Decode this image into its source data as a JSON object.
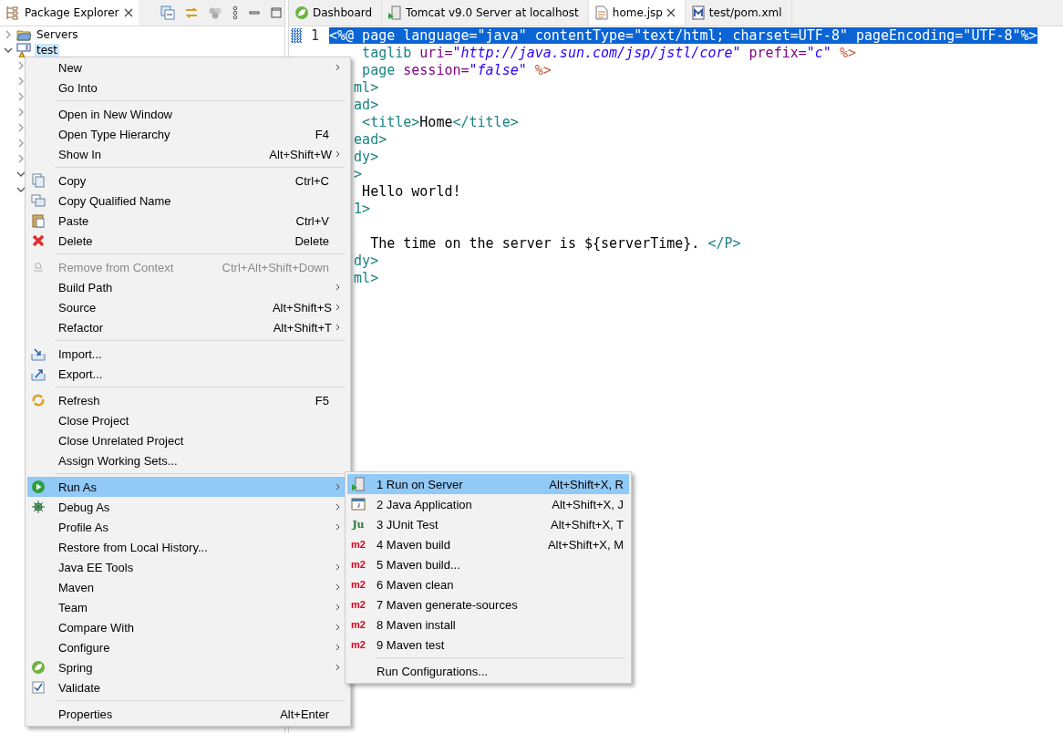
{
  "explorer": {
    "tab": {
      "label": "Package Explorer",
      "selected": true
    },
    "tree": [
      {
        "label": "Servers",
        "expanded": false,
        "selected": false
      },
      {
        "label": "test",
        "expanded": true,
        "selected": true,
        "children": [
          {
            "expanded": false
          },
          {
            "expanded": false
          },
          {
            "expanded": false
          },
          {
            "expanded": false
          },
          {
            "expanded": false
          },
          {
            "expanded": false
          },
          {
            "expanded": false
          },
          {
            "expanded": true
          },
          {
            "expanded": true
          }
        ]
      }
    ]
  },
  "editor": {
    "tabs": [
      {
        "label": "Dashboard",
        "kind": "spring",
        "selected": false
      },
      {
        "label": "Tomcat v9.0 Server at localhost",
        "kind": "server",
        "selected": false
      },
      {
        "label": "home.jsp",
        "kind": "file",
        "selected": true
      },
      {
        "label": "test/pom.xml",
        "kind": "maven",
        "selected": false
      }
    ],
    "line_number": "1",
    "blocks": [
      [
        {
          "selected": true,
          "segments": [
            {
              "text": "<%@ page language=\"java\" contentType=\"text/html; charset=UTF-8\" pageEncoding=\"UTF-8\"%>",
              "kind": "plain"
            }
          ]
        },
        {
          "selected": false,
          "segments": [
            {
              "text": "    taglib ",
              "kind": "tag"
            },
            {
              "text": "uri=",
              "kind": "attr"
            },
            {
              "text": "\"http://java.sun.com/jsp/jstl/core\"",
              "kind": "str"
            },
            {
              "text": " prefix=",
              "kind": "attr"
            },
            {
              "text": "\"c\"",
              "kind": "str"
            },
            {
              "text": " %>",
              "kind": "dir"
            }
          ]
        },
        {
          "selected": false,
          "segments": [
            {
              "text": "    page ",
              "kind": "tag"
            },
            {
              "text": "session=",
              "kind": "attr"
            },
            {
              "text": "\"false\"",
              "kind": "str"
            },
            {
              "text": " %>",
              "kind": "dir"
            }
          ]
        },
        {
          "selected": false,
          "segments": [
            {
              "text": "   ml>",
              "kind": "tag"
            }
          ]
        },
        {
          "selected": false,
          "segments": [
            {
              "text": "   ad>",
              "kind": "tag"
            }
          ]
        },
        {
          "selected": false,
          "segments": [
            {
              "text": "    <title>",
              "kind": "tag"
            },
            {
              "text": "Home",
              "kind": "plain"
            },
            {
              "text": "</title>",
              "kind": "tag"
            }
          ]
        },
        {
          "selected": false,
          "segments": [
            {
              "text": "   ead>",
              "kind": "tag"
            }
          ]
        },
        {
          "selected": false,
          "segments": [
            {
              "text": "   dy>",
              "kind": "tag"
            }
          ]
        },
        {
          "selected": false,
          "segments": [
            {
              "text": "   >",
              "kind": "tag"
            }
          ]
        },
        {
          "selected": false,
          "segments": [
            {
              "text": "    Hello world!",
              "kind": "plain"
            }
          ]
        },
        {
          "selected": false,
          "segments": [
            {
              "text": "   1>",
              "kind": "tag"
            }
          ]
        }
      ],
      [
        {
          "selected": false,
          "segments": [
            {
              "text": "     The time on the server is ${serverTime}. ",
              "kind": "plain"
            },
            {
              "text": "</P>",
              "kind": "tag"
            }
          ]
        },
        {
          "selected": false,
          "segments": [
            {
              "text": "   dy>",
              "kind": "tag"
            }
          ]
        },
        {
          "selected": false,
          "segments": [
            {
              "text": "   ml>",
              "kind": "tag"
            }
          ]
        }
      ]
    ]
  },
  "context_menu": {
    "groups": [
      [
        {
          "label": "New",
          "submenu": true
        },
        {
          "label": "Go Into"
        }
      ],
      [
        {
          "label": "Open in New Window"
        },
        {
          "label": "Open Type Hierarchy",
          "shortcut": "F4"
        },
        {
          "label": "Show In",
          "shortcut": "Alt+Shift+W",
          "submenu": true
        }
      ],
      [
        {
          "label": "Copy",
          "shortcut": "Ctrl+C",
          "kind": "copy"
        },
        {
          "label": "Copy Qualified Name",
          "kind": "copyname"
        },
        {
          "label": "Paste",
          "shortcut": "Ctrl+V",
          "kind": "paste"
        },
        {
          "label": "Delete",
          "shortcut": "Delete",
          "kind": "delete"
        }
      ],
      [
        {
          "label": "Remove from Context",
          "shortcut": "Ctrl+Alt+Shift+Down",
          "kind": "remove",
          "disabled": true
        },
        {
          "label": "Build Path",
          "submenu": true
        },
        {
          "label": "Source",
          "shortcut": "Alt+Shift+S",
          "submenu": true
        },
        {
          "label": "Refactor",
          "shortcut": "Alt+Shift+T",
          "submenu": true
        }
      ],
      [
        {
          "label": "Import...",
          "kind": "import"
        },
        {
          "label": "Export...",
          "kind": "export"
        }
      ],
      [
        {
          "label": "Refresh",
          "shortcut": "F5",
          "kind": "refresh"
        },
        {
          "label": "Close Project"
        },
        {
          "label": "Close Unrelated Project"
        },
        {
          "label": "Assign Working Sets..."
        }
      ],
      [
        {
          "label": "Run As",
          "submenu": true,
          "kind": "run",
          "selected": true
        },
        {
          "label": "Debug As",
          "submenu": true,
          "kind": "debug"
        },
        {
          "label": "Profile As",
          "submenu": true
        },
        {
          "label": "Restore from Local History..."
        },
        {
          "label": "Java EE Tools",
          "submenu": true
        },
        {
          "label": "Maven",
          "submenu": true
        },
        {
          "label": "Team",
          "submenu": true
        },
        {
          "label": "Compare With",
          "submenu": true
        },
        {
          "label": "Configure",
          "submenu": true
        },
        {
          "label": "Spring",
          "submenu": true,
          "kind": "spring"
        },
        {
          "label": "Validate",
          "kind": "check"
        }
      ],
      [
        {
          "label": "Properties",
          "shortcut": "Alt+Enter"
        }
      ]
    ]
  },
  "run_as_submenu": {
    "groups": [
      [
        {
          "label": "1 Run on Server",
          "shortcut": "Alt+Shift+X, R",
          "kind": "server",
          "selected": true
        },
        {
          "label": "2 Java Application",
          "shortcut": "Alt+Shift+X, J",
          "kind": "java",
          "selected": false
        },
        {
          "label": "3 JUnit Test",
          "shortcut": "Alt+Shift+X, T",
          "badge": "Ju",
          "kind": "junit",
          "selected": false
        },
        {
          "label": "4 Maven build",
          "shortcut": "Alt+Shift+X, M",
          "badge": "m2",
          "kind": "maven",
          "selected": false
        },
        {
          "label": "5 Maven build...",
          "badge": "m2",
          "kind": "maven",
          "selected": false
        },
        {
          "label": "6 Maven clean",
          "badge": "m2",
          "kind": "maven",
          "selected": false
        },
        {
          "label": "7 Maven generate-sources",
          "badge": "m2",
          "kind": "maven",
          "selected": false
        },
        {
          "label": "8 Maven install",
          "badge": "m2",
          "kind": "maven",
          "selected": false
        },
        {
          "label": "9 Maven test",
          "badge": "m2",
          "kind": "maven",
          "selected": false
        }
      ],
      [
        {
          "label": "Run Configurations...",
          "selected": false
        }
      ]
    ]
  }
}
